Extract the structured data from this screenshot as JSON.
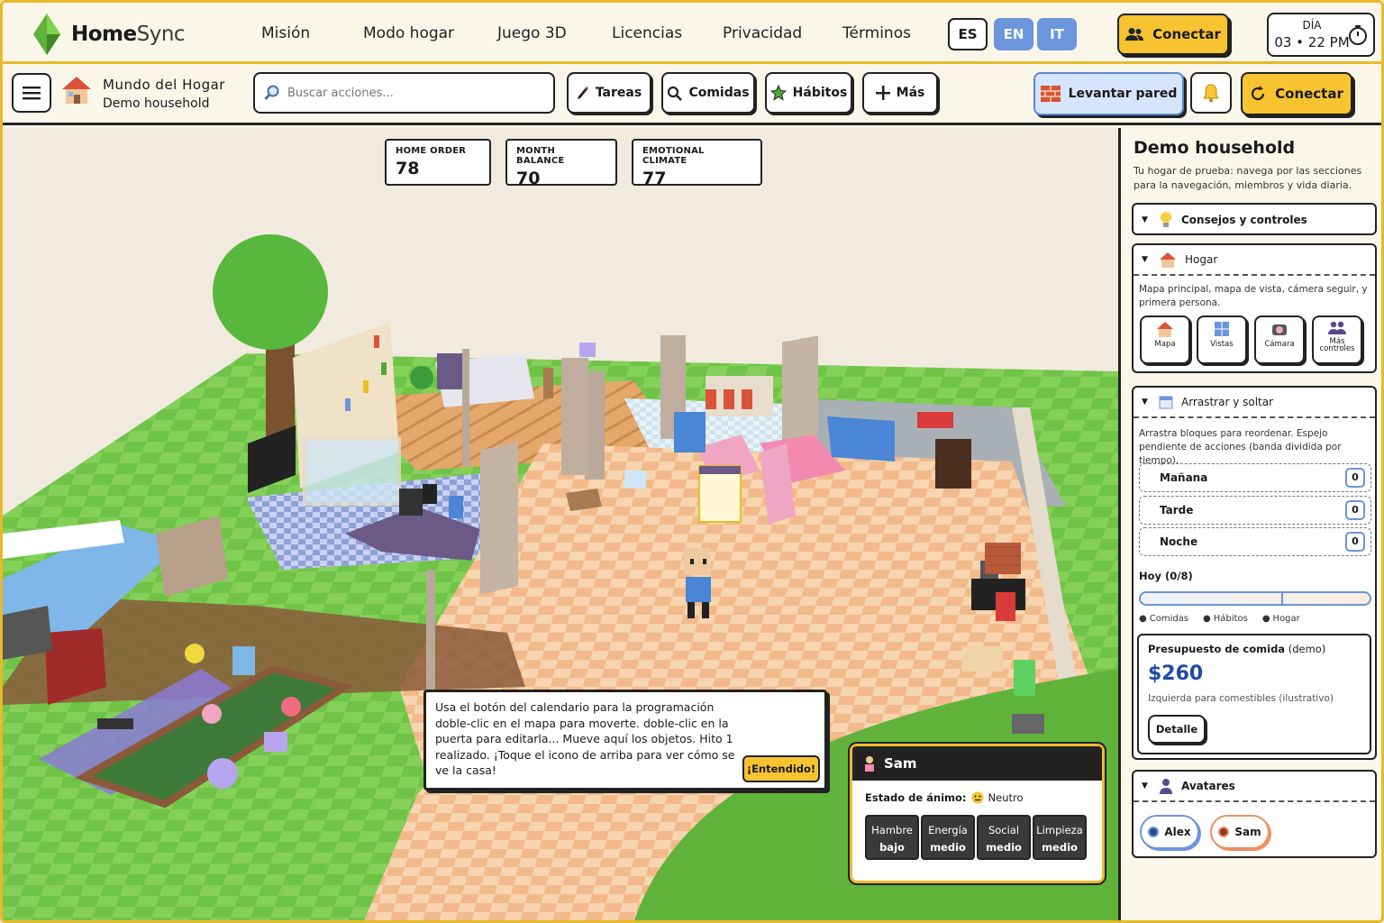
{
  "brand": {
    "name_bold": "Home",
    "name_light": "Sync"
  },
  "nav": [
    "Misión",
    "Modo hogar",
    "Juego 3D",
    "Licencias",
    "Privacidad",
    "Términos"
  ],
  "langs": [
    {
      "code": "ES",
      "active": true
    },
    {
      "code": "EN",
      "active": false
    },
    {
      "code": "IT",
      "active": false
    }
  ],
  "connect_top": "Conectar",
  "day": {
    "label": "DÍA",
    "value": "03 • 22 PM"
  },
  "toolbar": {
    "world_title": "Mundo del Hogar",
    "world_sub": "Demo household",
    "search_placeholder": "Buscar acciones...",
    "buttons": [
      "Tareas",
      "Comidas",
      "Hábitos",
      "Más"
    ],
    "raise_wall": "Levantar pared",
    "connect": "Conectar"
  },
  "stats": [
    {
      "label": "HOME ORDER",
      "value": "78"
    },
    {
      "label": "MONTH BALANCE",
      "value": "70"
    },
    {
      "label": "EMOTIONAL CLIMATE",
      "value": "77"
    }
  ],
  "tip": {
    "text": "Usa el botón del calendario para la programación doble-clic en el mapa para moverte. doble-clic en la puerta para editarla... Mueve aquí los objetos. Hito 1 realizado. ¡Toque el icono de arriba para ver cómo se ve la casa!",
    "ok": "¡Entendido!"
  },
  "sam": {
    "name": "Sam",
    "mood_label": "Estado de ánimo:",
    "mood_value": "Neutro",
    "needs": [
      {
        "name": "Hambre",
        "level": "bajo"
      },
      {
        "name": "Energía",
        "level": "medio"
      },
      {
        "name": "Social",
        "level": "medio"
      },
      {
        "name": "Limpieza",
        "level": "medio"
      }
    ]
  },
  "panel": {
    "title": "Demo household",
    "desc": "Tu hogar de prueba: navega por las secciones para la navegación, miembros y vida diaria.",
    "tips_card": "Consejos y controles",
    "home_card": {
      "title": "Hogar",
      "desc": "Mapa principal, mapa de vista, cámera seguir, y primera persona.",
      "tiles": [
        "Mapa",
        "Vistas",
        "Cámara",
        "Más controles"
      ]
    },
    "drag_card": {
      "title": "Arrastrar y soltar",
      "desc": "Arrastra bloques para reordenar. Espejo pendiente de acciones (banda dividida por tiempo).",
      "slots": [
        {
          "name": "Mañana",
          "count": "0"
        },
        {
          "name": "Tarde",
          "count": "0"
        },
        {
          "name": "Noche",
          "count": "0"
        }
      ],
      "today": "Hoy (0/8)",
      "legend": [
        "Comidas",
        "Hábitos",
        "Hogar"
      ]
    },
    "budget": {
      "title_bold": "Presupuesto de comida",
      "title_light": "(demo)",
      "amount": "$260",
      "note": "Izquierda para comestibles (ilustrativo)",
      "button": "Detalle"
    },
    "avatars": {
      "title": "Avatares",
      "people": [
        "Alex",
        "Sam"
      ]
    }
  },
  "colors": {
    "accent_yellow": "#f7c331",
    "frame": "#e7b92c",
    "blue": "#6b95dd",
    "grass": "#6fc347"
  }
}
